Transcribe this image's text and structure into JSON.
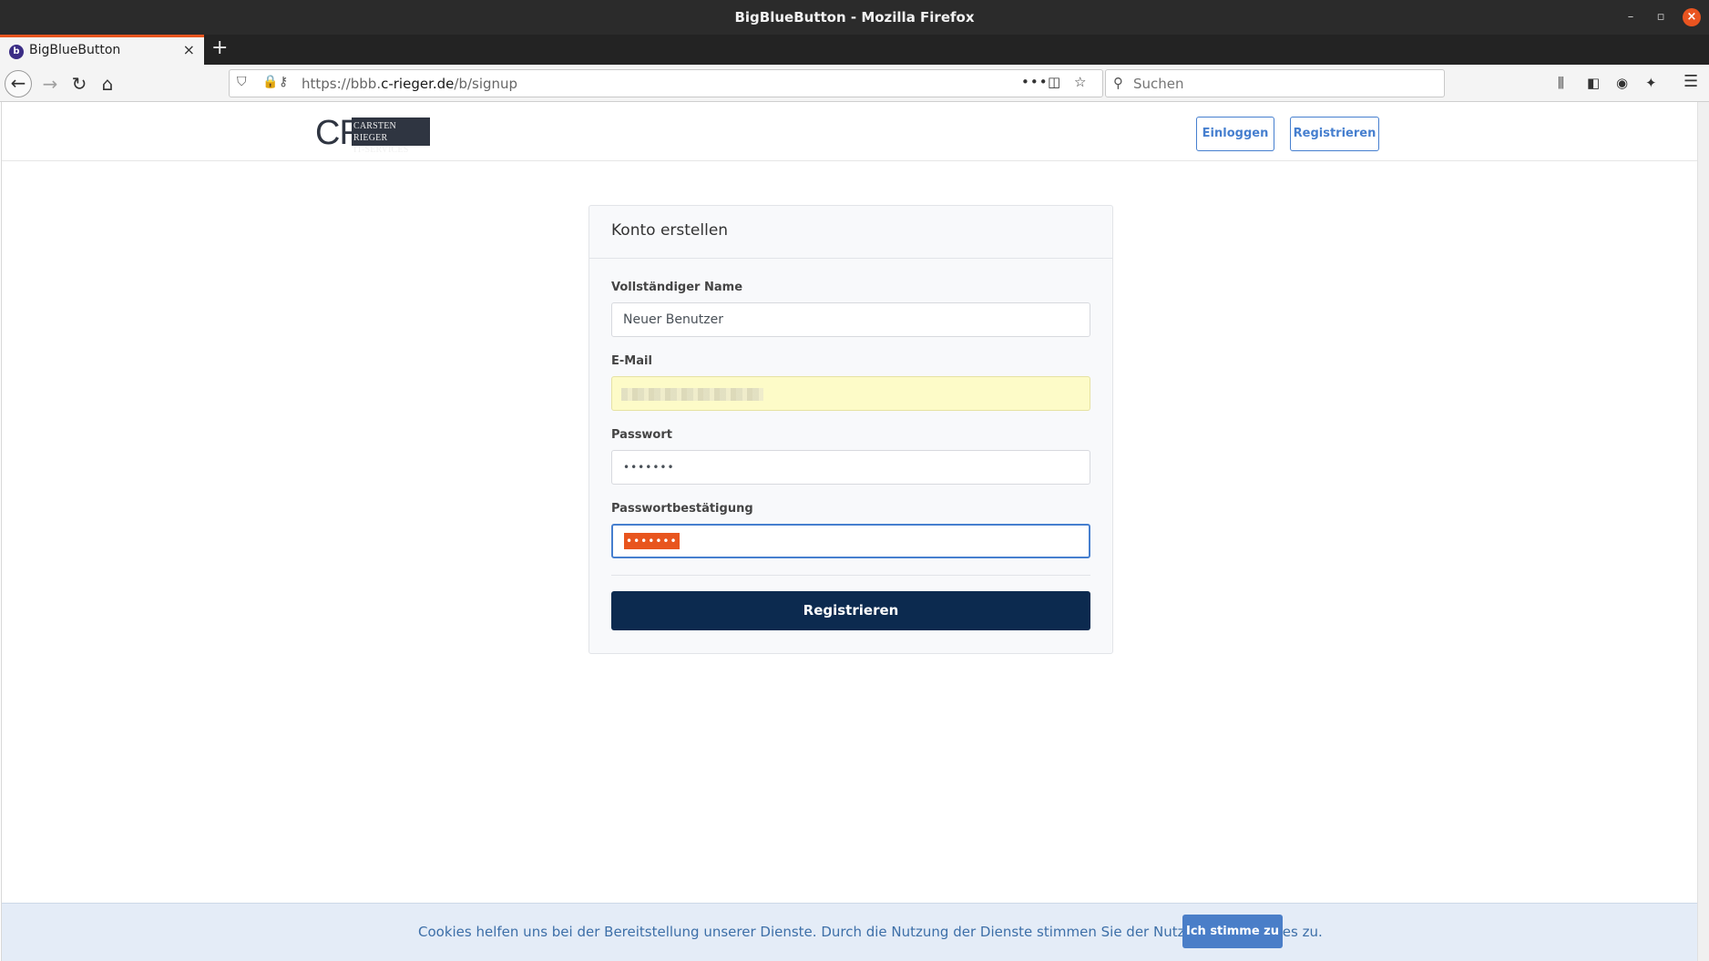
{
  "window": {
    "title": "BigBlueButton - Mozilla Firefox",
    "minimize_glyph": "–",
    "restore_glyph": "▫",
    "close_glyph": "×"
  },
  "tabs": [
    {
      "title": "BigBlueButton",
      "favicon": "b",
      "close_glyph": "×"
    }
  ],
  "new_tab_glyph": "+",
  "nav": {
    "url_prefix": "https://bbb.",
    "url_domain": "c-rieger.de",
    "url_path": "/b/signup",
    "search_placeholder": "Suchen"
  },
  "icons": {
    "back": "←",
    "forward": "→",
    "reload": "↻",
    "home": "⌂",
    "shield": "⛉",
    "lock": "🔒",
    "key": "⚷",
    "more": "•••",
    "pocket": "◫",
    "star": "☆",
    "search": "⚲",
    "library": "⫼",
    "sidebar": "◧",
    "account": "◉",
    "extension": "✦",
    "menu": "☰"
  },
  "site": {
    "logo_letters": "CR",
    "logo_box_text": "Carsten Rieger\nIt-Services",
    "login_label": "Einloggen",
    "signup_label": "Registrieren"
  },
  "form": {
    "title": "Konto erstellen",
    "name_label": "Vollständiger Name",
    "name_value": "Neuer Benutzer",
    "email_label": "E-Mail",
    "password_label": "Passwort",
    "password_value": "•••••••",
    "password_confirm_label": "Passwortbestätigung",
    "password_confirm_value": "•••••••",
    "submit_label": "Registrieren"
  },
  "cookie": {
    "message": "Cookies helfen uns bei der Bereitstellung unserer Dienste. Durch die Nutzung der Dienste stimmen Sie der Nutzung von Cookies zu.",
    "accept_label": "Ich stimme zu"
  },
  "colors": {
    "accent": "#467fcf",
    "submit_bg": "#0c2a4f",
    "autofill_bg": "#fdfbc8",
    "tab_highlight": "#e8551e"
  }
}
